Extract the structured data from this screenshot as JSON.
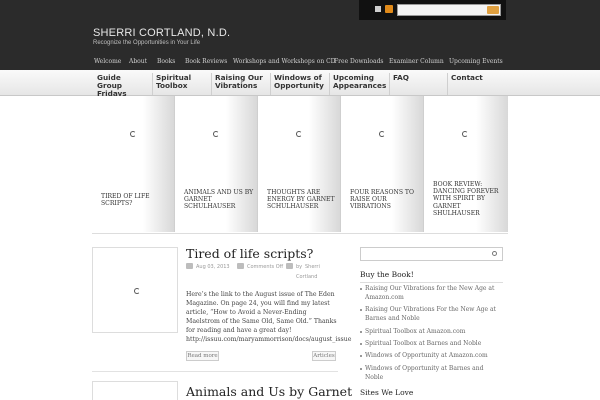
{
  "header": {
    "title": "SHERRI CORTLAND, N.D.",
    "tagline": "Recognize the Opportunities in Your Life",
    "search_icon": "search-icon",
    "rss_icon": "rss-icon"
  },
  "top_nav": [
    "Welcome",
    "About",
    "Books",
    "Book Reviews",
    "Workshops and Workshops on CD",
    "Free Downloads",
    "Examiner Column",
    "Upcoming Events"
  ],
  "main_nav": [
    "Guide Group Fridays",
    "Spiritual Toolbox",
    "Raising Our Vibrations",
    "Windows of Opportunity",
    "Upcoming Appearances",
    "FAQ",
    "Contact"
  ],
  "featured": [
    "TIRED OF LIFE SCRIPTS?",
    "ANIMALS AND US BY GARNET SCHULHAUSER",
    "THOUGHTS ARE ENERGY BY GARNET SCHULHAUSER",
    "FOUR REASONS TO RAISE OUR VIBRATIONS",
    "BOOK REVIEW: DANCING FOREVER WITH SPIRIT BY GARNET SHULHAUSER"
  ],
  "post": {
    "title": "Tired of life scripts?",
    "date": "Aug 03, 2013",
    "comments": "Comments Off",
    "author_prefix": "by",
    "author_first": "Sherri",
    "author_last": "Cortland",
    "excerpt": "Here’s the link to the August issue of The Eden Magazine. On page 24, you will find my latest article, “How to Avoid a Never-Ending Maelstrom of the Same Old, Same Old.” Thanks for reading and have a great day! http://issuu.com/maryammorrison/docs/august_issue",
    "read_more": "Read more",
    "category": "Articles"
  },
  "post2": {
    "title": "Animals and Us by Garnet"
  },
  "sidebar": {
    "buy_title": "Buy the Book!",
    "links": [
      "Raising Our Vibrations for the New Age at Amazon.com",
      "Raising Our Vibrations For the New Age at Barnes and Noble",
      "Spiritual Toolbox at Amazon.com",
      "Spiritual Toolbox at Barnes and Noble",
      "Windows of Opportunity at Amazon.com",
      "Windows of Opportunity at Barnes and Noble"
    ],
    "sites_title": "Sites We Love"
  }
}
